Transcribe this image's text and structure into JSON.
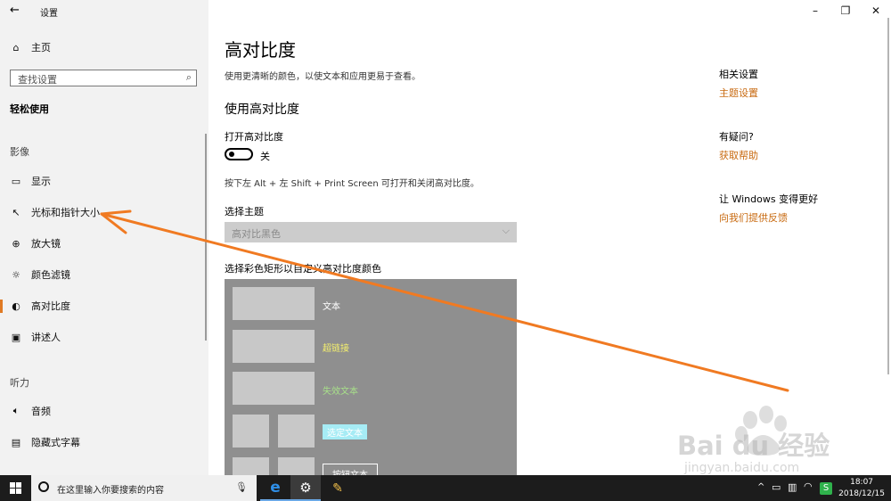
{
  "window": {
    "title": "设置",
    "back_icon": "back-arrow-icon",
    "minimize_glyph": "–",
    "restore_glyph": "❐",
    "close_glyph": "✕"
  },
  "sidebar": {
    "home_label": "主页",
    "search_placeholder": "查找设置",
    "category": "轻松使用",
    "section_vision": "影像",
    "section_hearing": "听力",
    "items": [
      {
        "label": "显示",
        "icon": "monitor-icon"
      },
      {
        "label": "光标和指针大小",
        "icon": "cursor-icon"
      },
      {
        "label": "放大镜",
        "icon": "magnifier-icon"
      },
      {
        "label": "颜色滤镜",
        "icon": "color-filter-icon"
      },
      {
        "label": "高对比度",
        "icon": "contrast-icon",
        "selected": true
      },
      {
        "label": "讲述人",
        "icon": "narrator-icon"
      },
      {
        "label": "音频",
        "icon": "speaker-icon"
      },
      {
        "label": "隐藏式字幕",
        "icon": "captions-icon"
      }
    ],
    "accent_color": "#e07a24"
  },
  "main": {
    "title": "高对比度",
    "description": "使用更清晰的颜色，以使文本和应用更易于查看。",
    "section_title": "使用高对比度",
    "toggle_label": "打开高对比度",
    "toggle_state": "关",
    "shortcut_hint": "按下左 Alt + 左 Shift + Print Screen 可打开和关闭高对比度。",
    "theme_label": "选择主题",
    "theme_value": "高对比黑色",
    "palette_label": "选择彩色矩形以自定义高对比度颜色",
    "palette": {
      "text": "文本",
      "hyperlink": "超链接",
      "disabled_text": "失效文本",
      "selected_text": "选定文本",
      "button_text": "按钮文本",
      "hyperlink_color": "#f5f06e",
      "disabled_color": "#a8e08a",
      "selected_bg": "#a6ecf5"
    }
  },
  "right_panel": {
    "related_title": "相关设置",
    "related_link": "主题设置",
    "question_title": "有疑问?",
    "question_link": "获取帮助",
    "improve_title": "让 Windows 变得更好",
    "improve_link": "向我们提供反馈",
    "link_color": "#c86a10"
  },
  "taskbar": {
    "search_placeholder": "在这里输入你要搜索的内容",
    "time": "18:07",
    "date": "2018/12/15"
  },
  "watermark": {
    "brand": "Bai du 经验",
    "url": "jingyan.baidu.com"
  },
  "annotation_color": "#f07a22"
}
